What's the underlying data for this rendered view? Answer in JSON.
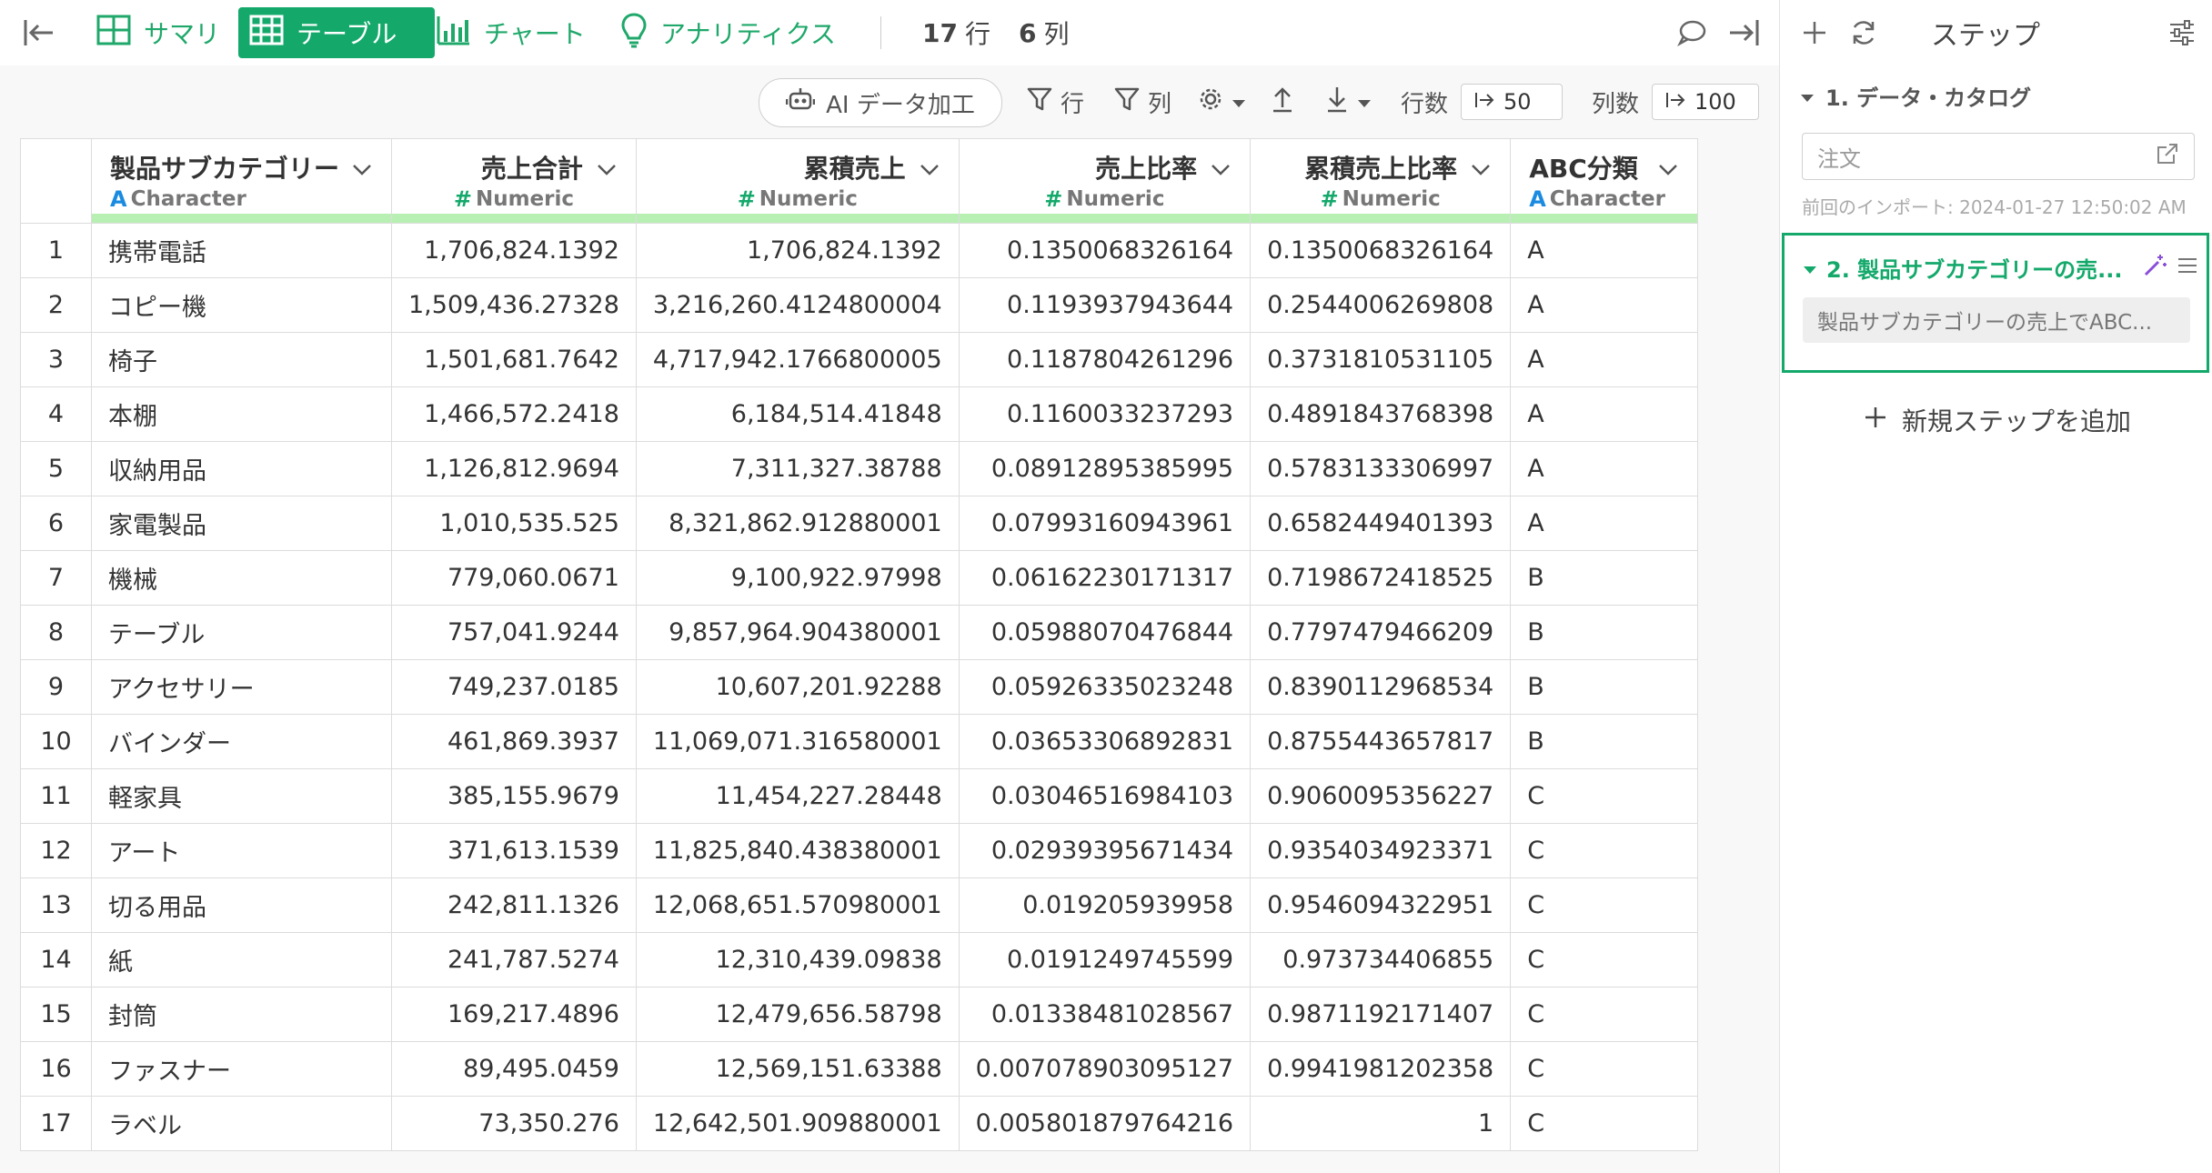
{
  "topbar": {
    "tabs": [
      {
        "label": "サマリ",
        "icon": "summary-grid-icon"
      },
      {
        "label": "テーブル",
        "icon": "table-icon"
      },
      {
        "label": "チャート",
        "icon": "bar-chart-icon"
      },
      {
        "label": "アナリティクス",
        "icon": "lightbulb-icon"
      }
    ],
    "rows_count": "17",
    "rows_unit": "行",
    "cols_count": "6",
    "cols_unit": "列"
  },
  "toolbar": {
    "ai_label": "AI データ加工",
    "row_filter_label": "行",
    "col_filter_label": "列",
    "rows_label": "行数",
    "rows_value": "50",
    "cols_label": "列数",
    "cols_value": "100"
  },
  "table": {
    "columns": [
      {
        "name": "製品サブカテゴリー",
        "type_glyph": "A",
        "type": "Character"
      },
      {
        "name": "売上合計",
        "type_glyph": "#",
        "type": "Numeric"
      },
      {
        "name": "累積売上",
        "type_glyph": "#",
        "type": "Numeric"
      },
      {
        "name": "売上比率",
        "type_glyph": "#",
        "type": "Numeric"
      },
      {
        "name": "累積売上比率",
        "type_glyph": "#",
        "type": "Numeric"
      },
      {
        "name": "ABC分類",
        "type_glyph": "A",
        "type": "Character"
      }
    ],
    "rows": [
      [
        "1",
        "携帯電話",
        "1,706,824.1392",
        "1,706,824.1392",
        "0.1350068326164",
        "0.1350068326164",
        "A"
      ],
      [
        "2",
        "コピー機",
        "1,509,436.27328",
        "3,216,260.4124800004",
        "0.1193937943644",
        "0.2544006269808",
        "A"
      ],
      [
        "3",
        "椅子",
        "1,501,681.7642",
        "4,717,942.1766800005",
        "0.1187804261296",
        "0.3731810531105",
        "A"
      ],
      [
        "4",
        "本棚",
        "1,466,572.2418",
        "6,184,514.41848",
        "0.1160033237293",
        "0.4891843768398",
        "A"
      ],
      [
        "5",
        "収納用品",
        "1,126,812.9694",
        "7,311,327.38788",
        "0.08912895385995",
        "0.5783133306997",
        "A"
      ],
      [
        "6",
        "家電製品",
        "1,010,535.525",
        "8,321,862.912880001",
        "0.07993160943961",
        "0.6582449401393",
        "A"
      ],
      [
        "7",
        "機械",
        "779,060.0671",
        "9,100,922.97998",
        "0.06162230171317",
        "0.7198672418525",
        "B"
      ],
      [
        "8",
        "テーブル",
        "757,041.9244",
        "9,857,964.904380001",
        "0.05988070476844",
        "0.7797479466209",
        "B"
      ],
      [
        "9",
        "アクセサリー",
        "749,237.0185",
        "10,607,201.92288",
        "0.05926335023248",
        "0.8390112968534",
        "B"
      ],
      [
        "10",
        "バインダー",
        "461,869.3937",
        "11,069,071.316580001",
        "0.03653306892831",
        "0.8755443657817",
        "B"
      ],
      [
        "11",
        "軽家具",
        "385,155.9679",
        "11,454,227.28448",
        "0.03046516984103",
        "0.9060095356227",
        "C"
      ],
      [
        "12",
        "アート",
        "371,613.1539",
        "11,825,840.438380001",
        "0.02939395671434",
        "0.9354034923371",
        "C"
      ],
      [
        "13",
        "切る用品",
        "242,811.1326",
        "12,068,651.570980001",
        "0.019205939958",
        "0.9546094322951",
        "C"
      ],
      [
        "14",
        "紙",
        "241,787.5274",
        "12,310,439.09838",
        "0.0191249745599",
        "0.973734406855",
        "C"
      ],
      [
        "15",
        "封筒",
        "169,217.4896",
        "12,479,656.58798",
        "0.01338481028567",
        "0.9871192171407",
        "C"
      ],
      [
        "16",
        "ファスナー",
        "89,495.0459",
        "12,569,151.63388",
        "0.007078903095127",
        "0.9941981202358",
        "C"
      ],
      [
        "17",
        "ラベル",
        "73,350.276",
        "12,642,501.909880001",
        "0.005801879764216",
        "1",
        "C"
      ]
    ]
  },
  "panel": {
    "title": "ステップ",
    "step1_title": "1. データ・カタログ",
    "note_placeholder": "注文",
    "import_time": "前回のインポート: 2024-01-27 12:50:02 AM",
    "step2_title": "2. 製品サブカテゴリーの売...",
    "step2_subtitle": "製品サブカテゴリーの売上でABC...",
    "add_step_label": "新規ステップを追加"
  },
  "colors": {
    "accent": "#14a96b",
    "header_bar": "#b8f0b4",
    "character_type": "#1a8be0"
  }
}
